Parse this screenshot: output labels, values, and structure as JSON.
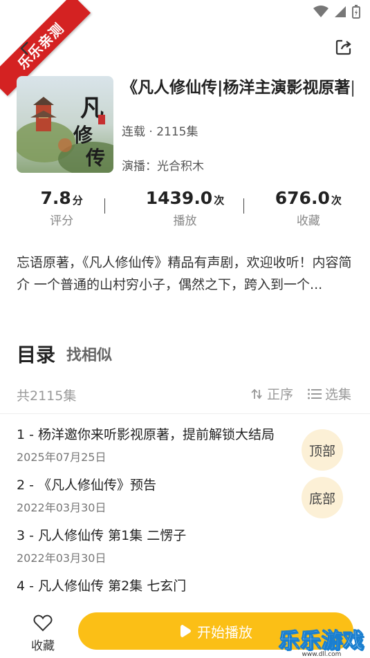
{
  "ribbon": "乐乐亲测",
  "header": {
    "title": "《凡人修仙传|杨洋主演影视原著|姜广涛",
    "meta": "连载 · 2115集",
    "cast": "演播：光合积木"
  },
  "stats": [
    {
      "value": "7.8",
      "unit": "分",
      "label": "评分"
    },
    {
      "value": "1439.0",
      "unit": "次",
      "label": "播放"
    },
    {
      "value": "676.0",
      "unit": "次",
      "label": "收藏"
    }
  ],
  "description": "忘语原著，《凡人修仙传》精品有声剧，欢迎收听！内容简介 一个普通的山村穷小子，偶然之下，跨入到一个...",
  "catalog": {
    "tab_active": "目录",
    "tab_other": "找相似",
    "count": "共2115集",
    "sort_label": "正序",
    "select_label": "选集"
  },
  "episodes": [
    {
      "title": "1 - 杨洋邀你来听影视原著，提前解锁大结局",
      "date": "2025年07月25日"
    },
    {
      "title": "2 - 《凡人修仙传》预告",
      "date": "2022年03月30日"
    },
    {
      "title": "3 - 凡人修仙传 第1集 二愣子",
      "date": "2022年03月30日"
    },
    {
      "title": "4 - 凡人修仙传 第2集 七玄门",
      "date": ""
    }
  ],
  "float_buttons": {
    "top": "顶部",
    "bottom": "底部"
  },
  "bottombar": {
    "fav_label": "收藏",
    "play_label": "开始播放"
  },
  "watermark": {
    "text": "乐乐游戏",
    "url": "www.dll.com"
  },
  "colors": {
    "accent": "#fbbf16",
    "ribbon": "#d42222",
    "float_bg": "#fcf0d6"
  }
}
